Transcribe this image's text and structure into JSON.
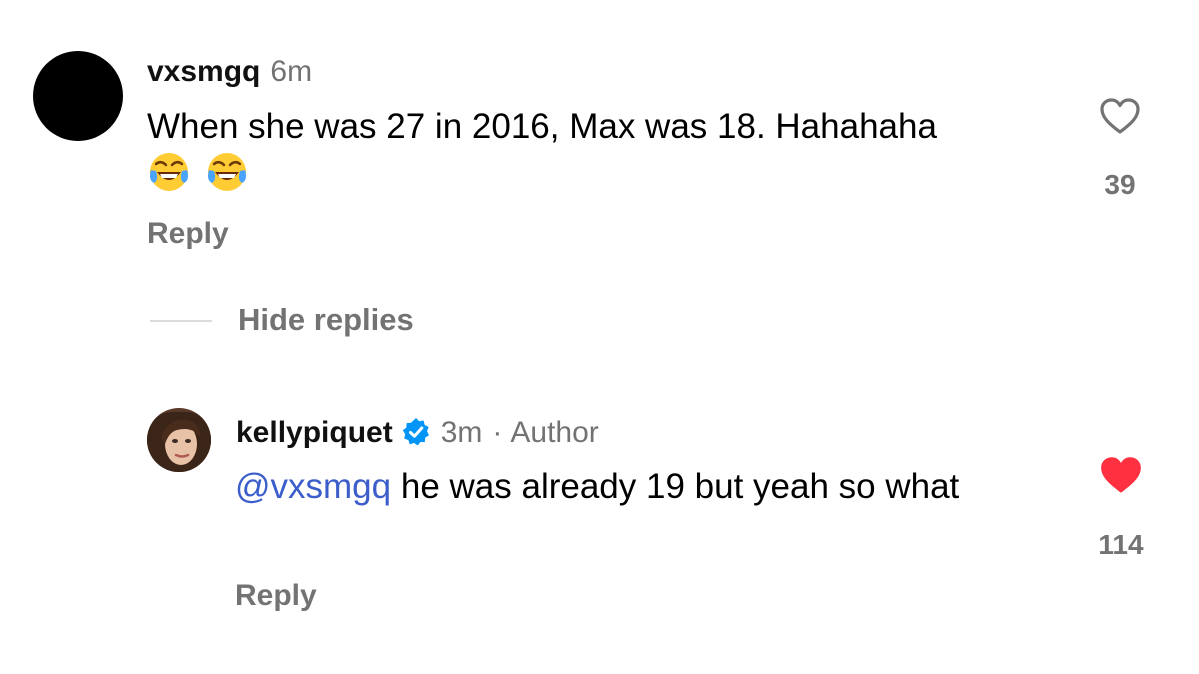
{
  "comments": [
    {
      "username": "vxsmgq",
      "time": "6m",
      "text": "When she was 27 in 2016, Max was 18. Hahahaha",
      "emojis": [
        "face-with-tears-of-joy",
        "face-with-tears-of-joy"
      ],
      "reply_label": "Reply",
      "likes": "39",
      "liked": false
    }
  ],
  "thread": {
    "toggle_label": "Hide replies"
  },
  "replies": [
    {
      "username": "kellypiquet",
      "verified": true,
      "time": "3m",
      "separator": "·",
      "role": "Author",
      "mention": "@vxsmgq",
      "text": "he was already 19 but yeah so what",
      "reply_label": "Reply",
      "likes": "114",
      "liked": true
    }
  ],
  "colors": {
    "secondary_text": "#737373",
    "mention": "#3c5ecb",
    "like_active": "#ff3040",
    "verified_badge": "#0095f6"
  }
}
